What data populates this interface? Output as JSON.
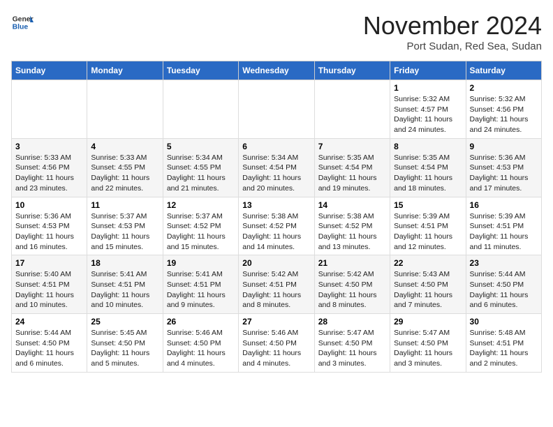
{
  "header": {
    "logo_general": "General",
    "logo_blue": "Blue",
    "month_title": "November 2024",
    "location": "Port Sudan, Red Sea, Sudan"
  },
  "weekdays": [
    "Sunday",
    "Monday",
    "Tuesday",
    "Wednesday",
    "Thursday",
    "Friday",
    "Saturday"
  ],
  "weeks": [
    [
      {
        "day": "",
        "info": ""
      },
      {
        "day": "",
        "info": ""
      },
      {
        "day": "",
        "info": ""
      },
      {
        "day": "",
        "info": ""
      },
      {
        "day": "",
        "info": ""
      },
      {
        "day": "1",
        "info": "Sunrise: 5:32 AM\nSunset: 4:57 PM\nDaylight: 11 hours and 24 minutes."
      },
      {
        "day": "2",
        "info": "Sunrise: 5:32 AM\nSunset: 4:56 PM\nDaylight: 11 hours and 24 minutes."
      }
    ],
    [
      {
        "day": "3",
        "info": "Sunrise: 5:33 AM\nSunset: 4:56 PM\nDaylight: 11 hours and 23 minutes."
      },
      {
        "day": "4",
        "info": "Sunrise: 5:33 AM\nSunset: 4:55 PM\nDaylight: 11 hours and 22 minutes."
      },
      {
        "day": "5",
        "info": "Sunrise: 5:34 AM\nSunset: 4:55 PM\nDaylight: 11 hours and 21 minutes."
      },
      {
        "day": "6",
        "info": "Sunrise: 5:34 AM\nSunset: 4:54 PM\nDaylight: 11 hours and 20 minutes."
      },
      {
        "day": "7",
        "info": "Sunrise: 5:35 AM\nSunset: 4:54 PM\nDaylight: 11 hours and 19 minutes."
      },
      {
        "day": "8",
        "info": "Sunrise: 5:35 AM\nSunset: 4:54 PM\nDaylight: 11 hours and 18 minutes."
      },
      {
        "day": "9",
        "info": "Sunrise: 5:36 AM\nSunset: 4:53 PM\nDaylight: 11 hours and 17 minutes."
      }
    ],
    [
      {
        "day": "10",
        "info": "Sunrise: 5:36 AM\nSunset: 4:53 PM\nDaylight: 11 hours and 16 minutes."
      },
      {
        "day": "11",
        "info": "Sunrise: 5:37 AM\nSunset: 4:53 PM\nDaylight: 11 hours and 15 minutes."
      },
      {
        "day": "12",
        "info": "Sunrise: 5:37 AM\nSunset: 4:52 PM\nDaylight: 11 hours and 15 minutes."
      },
      {
        "day": "13",
        "info": "Sunrise: 5:38 AM\nSunset: 4:52 PM\nDaylight: 11 hours and 14 minutes."
      },
      {
        "day": "14",
        "info": "Sunrise: 5:38 AM\nSunset: 4:52 PM\nDaylight: 11 hours and 13 minutes."
      },
      {
        "day": "15",
        "info": "Sunrise: 5:39 AM\nSunset: 4:51 PM\nDaylight: 11 hours and 12 minutes."
      },
      {
        "day": "16",
        "info": "Sunrise: 5:39 AM\nSunset: 4:51 PM\nDaylight: 11 hours and 11 minutes."
      }
    ],
    [
      {
        "day": "17",
        "info": "Sunrise: 5:40 AM\nSunset: 4:51 PM\nDaylight: 11 hours and 10 minutes."
      },
      {
        "day": "18",
        "info": "Sunrise: 5:41 AM\nSunset: 4:51 PM\nDaylight: 11 hours and 10 minutes."
      },
      {
        "day": "19",
        "info": "Sunrise: 5:41 AM\nSunset: 4:51 PM\nDaylight: 11 hours and 9 minutes."
      },
      {
        "day": "20",
        "info": "Sunrise: 5:42 AM\nSunset: 4:51 PM\nDaylight: 11 hours and 8 minutes."
      },
      {
        "day": "21",
        "info": "Sunrise: 5:42 AM\nSunset: 4:50 PM\nDaylight: 11 hours and 8 minutes."
      },
      {
        "day": "22",
        "info": "Sunrise: 5:43 AM\nSunset: 4:50 PM\nDaylight: 11 hours and 7 minutes."
      },
      {
        "day": "23",
        "info": "Sunrise: 5:44 AM\nSunset: 4:50 PM\nDaylight: 11 hours and 6 minutes."
      }
    ],
    [
      {
        "day": "24",
        "info": "Sunrise: 5:44 AM\nSunset: 4:50 PM\nDaylight: 11 hours and 6 minutes."
      },
      {
        "day": "25",
        "info": "Sunrise: 5:45 AM\nSunset: 4:50 PM\nDaylight: 11 hours and 5 minutes."
      },
      {
        "day": "26",
        "info": "Sunrise: 5:46 AM\nSunset: 4:50 PM\nDaylight: 11 hours and 4 minutes."
      },
      {
        "day": "27",
        "info": "Sunrise: 5:46 AM\nSunset: 4:50 PM\nDaylight: 11 hours and 4 minutes."
      },
      {
        "day": "28",
        "info": "Sunrise: 5:47 AM\nSunset: 4:50 PM\nDaylight: 11 hours and 3 minutes."
      },
      {
        "day": "29",
        "info": "Sunrise: 5:47 AM\nSunset: 4:50 PM\nDaylight: 11 hours and 3 minutes."
      },
      {
        "day": "30",
        "info": "Sunrise: 5:48 AM\nSunset: 4:51 PM\nDaylight: 11 hours and 2 minutes."
      }
    ]
  ]
}
